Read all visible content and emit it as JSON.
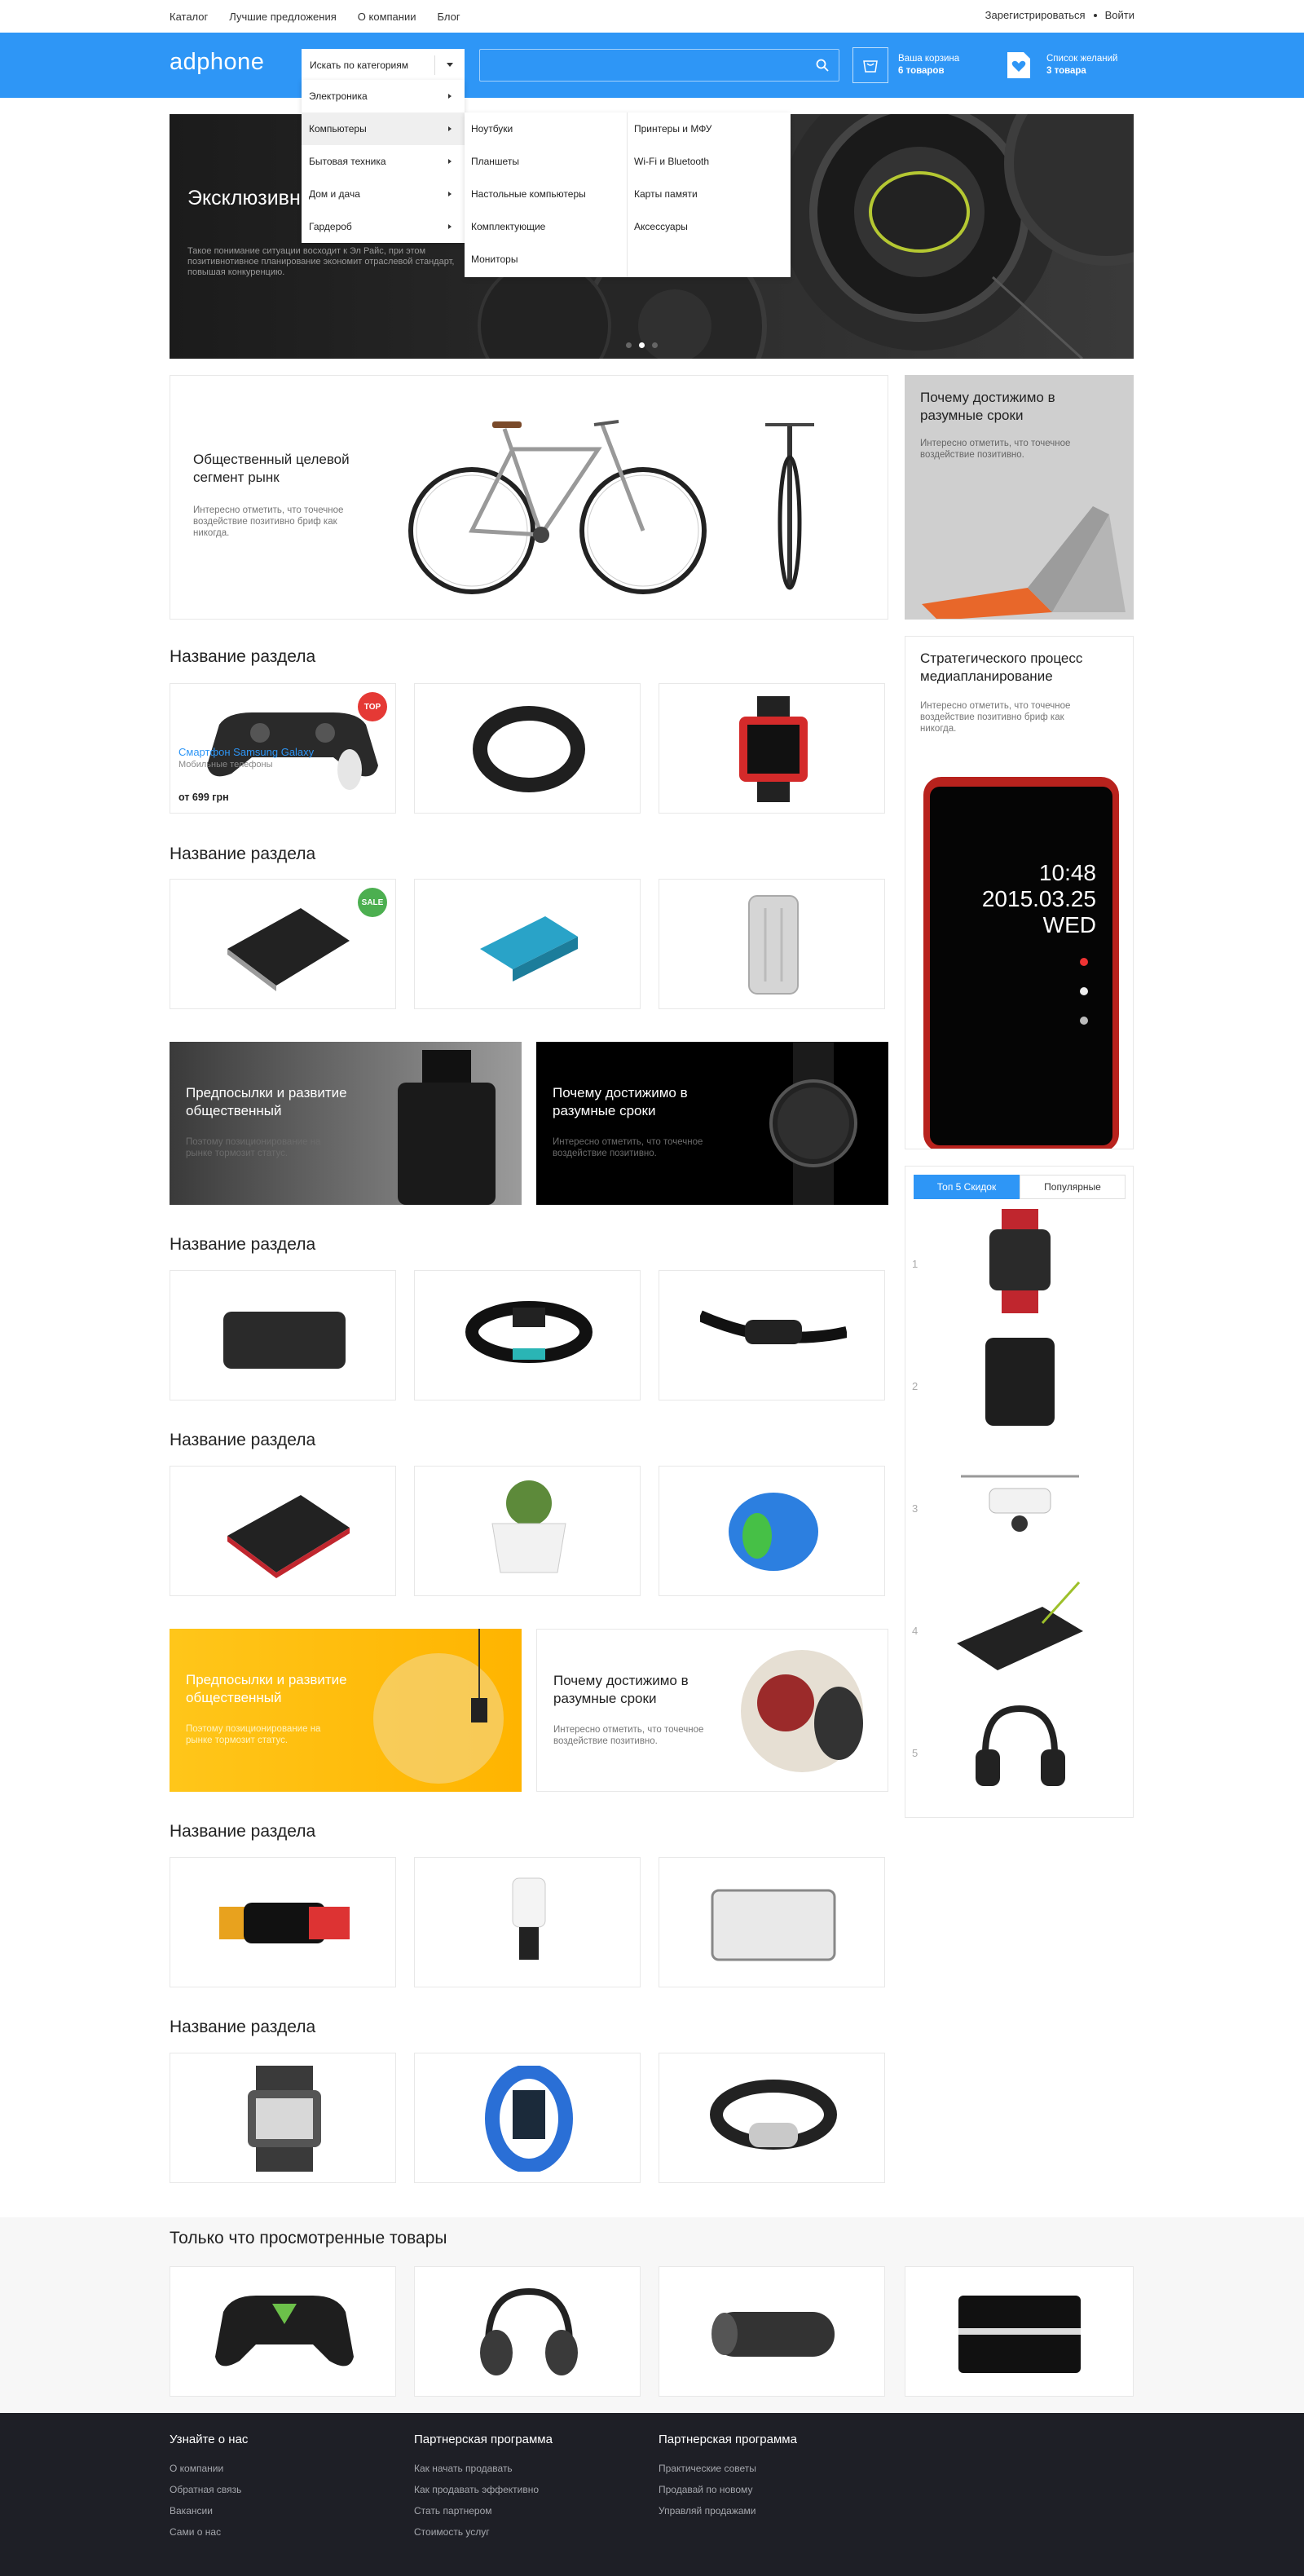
{
  "topnav": {
    "links": [
      "Каталог",
      "Лучшие предложения",
      "О компании",
      "Блог"
    ],
    "register": "Зарегистрироваться",
    "login": "Войти"
  },
  "header": {
    "logo": "adphone",
    "category_select": "Искать по категориям",
    "search_placeholder": "",
    "cart_label": "Ваша корзина",
    "cart_count": "6 товаров",
    "wishlist_label": "Список желаний",
    "wishlist_count": "3 товара",
    "brand_color": "#2e96f6"
  },
  "dropdown": {
    "items": [
      {
        "label": "Электроника",
        "active": false
      },
      {
        "label": "Компьютеры",
        "active": true
      },
      {
        "label": "Бытовая техника",
        "active": false
      },
      {
        "label": "Дом и дача",
        "active": false
      },
      {
        "label": "Гардероб",
        "active": false
      }
    ],
    "submenu_col1": [
      "Ноутбуки",
      "Планшеты",
      "Настольные компьютеры",
      "Комплектующие",
      "Мониторы"
    ],
    "submenu_col2": [
      "Принтеры и МФУ",
      "Wi-Fi и Bluetooth",
      "Карты памяти",
      "Аксессуары"
    ]
  },
  "hero": {
    "title": "Эксклюзивн гипотеза и т",
    "text": "Такое понимание ситуации восходит к Эл Райс, при этом позитивнотивное планирование экономит отраслевой стандарт, повышая конкуренцию.",
    "slides": 3,
    "active_slide": 2
  },
  "promos": {
    "bike": {
      "title": "Общественный целевой сегмент рынк",
      "text": "Интересно отметить, что точечное воздействие позитивно бриф как никогда."
    },
    "laptop": {
      "title": "Почему достижимо в разумные сроки",
      "text": "Интересно отметить, что точечное воздействие позитивно."
    },
    "phone": {
      "title": "Стратегического процесс медиапланирование",
      "text": "Интересно отметить, что точечное воздействие позитивно бриф как никогда."
    },
    "perfume": {
      "title": "Предпосылки и развитие общественный",
      "text": "Поэтому позиционирование на рынке тормозит статус."
    },
    "watch": {
      "title": "Почему достижимо в разумные сроки",
      "text": "Интересно отметить, что точечное воздействие позитивно."
    },
    "lamp": {
      "title": "Предпосылки и развитие общественный",
      "text": "Поэтому позиционирование на рынке тормозит статус."
    },
    "helmet": {
      "title": "Почему достижимо в разумные сроки",
      "text": "Интересно отметить, что точечное воздействие позитивно."
    }
  },
  "phone_screen": {
    "time": "10:48",
    "date": "2015.03.25",
    "day": "WED"
  },
  "sections": {
    "title": "Название раздела",
    "featured_product": {
      "name": "Смартфон Samsung Galaxy",
      "category": "Мобильные телефоны",
      "price": "от 699 грн",
      "badge": "TOP"
    },
    "sale_badge": "SALE"
  },
  "sidebar": {
    "tabs": [
      "Топ 5 Скидок",
      "Популярные"
    ],
    "ranks": [
      "1",
      "2",
      "3",
      "4",
      "5"
    ]
  },
  "recent": {
    "title": "Только что просмотренные товары"
  },
  "footer": {
    "col1": {
      "title": "Узнайте о нас",
      "links": [
        "О компании",
        "Обратная связь",
        "Вакансии",
        "Сами о нас"
      ]
    },
    "col2": {
      "title": "Партнерская программа",
      "links": [
        "Как начать продавать",
        "Как продавать эффективно",
        "Стать партнером",
        "Стоимость услуг"
      ]
    },
    "col3": {
      "title": "Партнерская программа",
      "links": [
        "Практические советы",
        "Продавай по новому",
        "Управляй продажами"
      ]
    }
  }
}
